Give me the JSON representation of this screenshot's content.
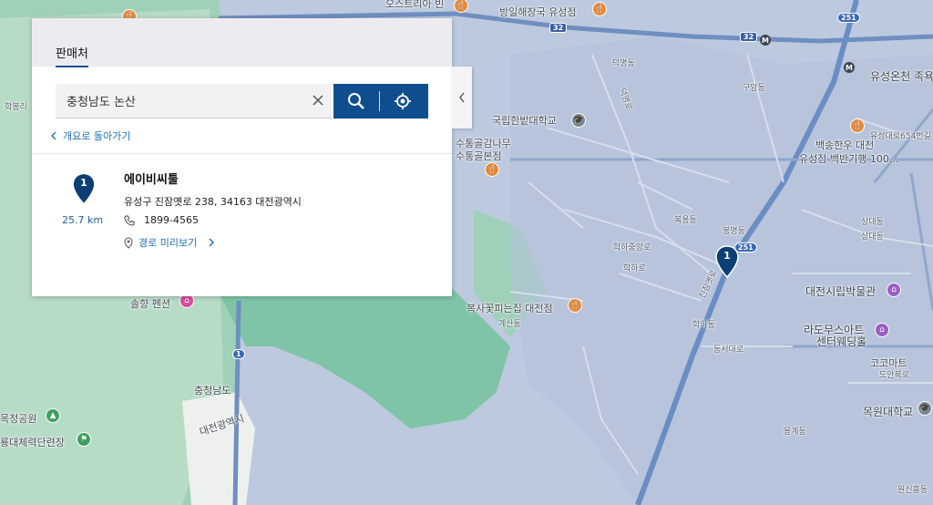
{
  "panel": {
    "tab_label": "판매처",
    "search": {
      "value": "충청남도 논산"
    },
    "back_label": "개요로 돌아가기",
    "result": {
      "index": "1",
      "distance": "25.7 km",
      "name": "에이비씨툴",
      "address": "유성구 진잠옛로 238, 34163 대전광역시",
      "phone": "1899-4565",
      "route_label": "경로 미리보기"
    }
  },
  "map": {
    "marker_label": "1",
    "labels": {
      "l1": "오스트리아 빈",
      "l2": "방일해장국 유성점",
      "l3": "유성온천 족욕",
      "l4": "구암동",
      "l5": "국립한밭대학교",
      "l6": "수통골감나무",
      "l7": "수통골본점",
      "l8": "백송한우 대전",
      "l9": "유성점 백반기행 100...",
      "l10": "유성대로654번길",
      "l11": "덕명동",
      "l12": "학하중앙로",
      "l13": "복용동",
      "l14": "상대동",
      "l15": "대전시립박물관",
      "l16": "라도무스아트",
      "l17": "센터웨딩홀",
      "l18": "코코마트",
      "l19": "도안북로",
      "l20": "목원대학교",
      "l21": "복사꽃피는집 대전점",
      "l22": "계산동",
      "l23": "학하동",
      "l24": "동서대로",
      "l25": "충청남도",
      "l26": "대전광역시",
      "l27": "목정공원",
      "l28": "룡대체력단련장",
      "l29": "용계동",
      "l30": "솔향 펜션",
      "l31": "학봉리",
      "l32": "진잠옛로",
      "l33": "봉명동",
      "l34": "원신흥동",
      "l35": "학하로",
      "l36": "덕명로",
      "l37": "상대동"
    },
    "shields": {
      "s32a": "32",
      "s32b": "32",
      "s251a": "251",
      "s251b": "251",
      "s1": "1"
    },
    "metro": "M"
  },
  "colors": {
    "accent": "#0e4e8e",
    "link": "#1f6fb5",
    "marker": "#0c3f73",
    "map_urban": "#b9c6dc",
    "map_green": "#8fcbb1"
  },
  "icons": {
    "clear": "close-icon",
    "search": "search-icon",
    "locate": "crosshair-icon",
    "back": "chevron-left-icon",
    "phone": "phone-icon",
    "route": "map-pin-outline-icon",
    "collapse": "chevron-left-icon"
  }
}
